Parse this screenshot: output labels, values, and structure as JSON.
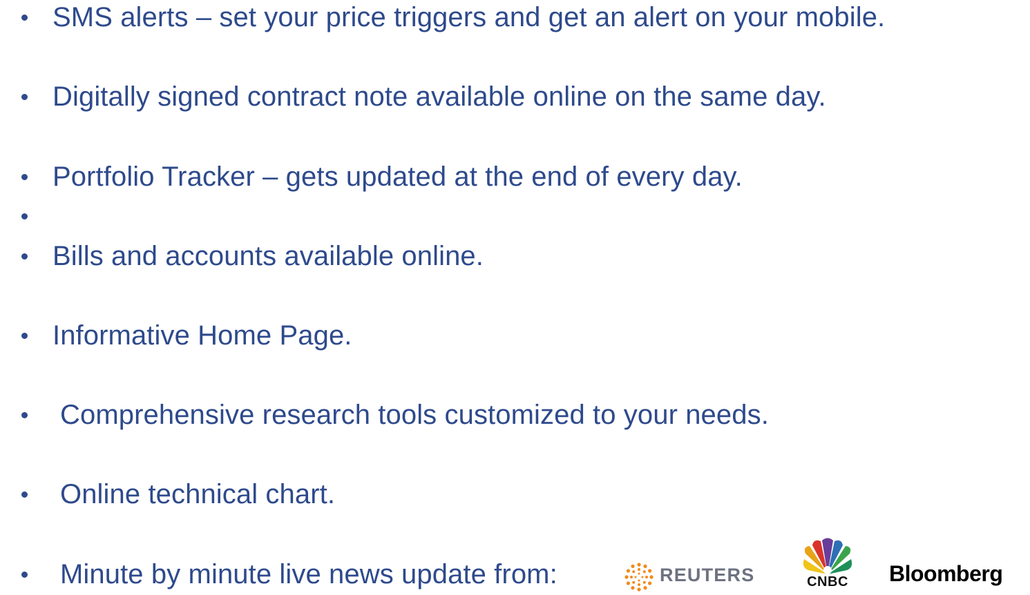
{
  "bullets": [
    "SMS alerts – set your price triggers and get an alert on your mobile.",
    "Digitally signed contract note available online on the same day.",
    "Portfolio Tracker – gets updated at the end of every day.",
    "",
    "Bills and accounts available online.",
    "Informative Home Page.",
    "Comprehensive research tools customized to your needs.",
    "Online technical chart.",
    "Minute by minute live news update from:"
  ],
  "logos": {
    "reuters": "REUTERS",
    "cnbc": "CNBC",
    "bloomberg": "Bloomberg"
  },
  "colors": {
    "text": "#2e4a8c",
    "reuters_orange": "#f28a1b",
    "reuters_word": "#6d7280"
  }
}
